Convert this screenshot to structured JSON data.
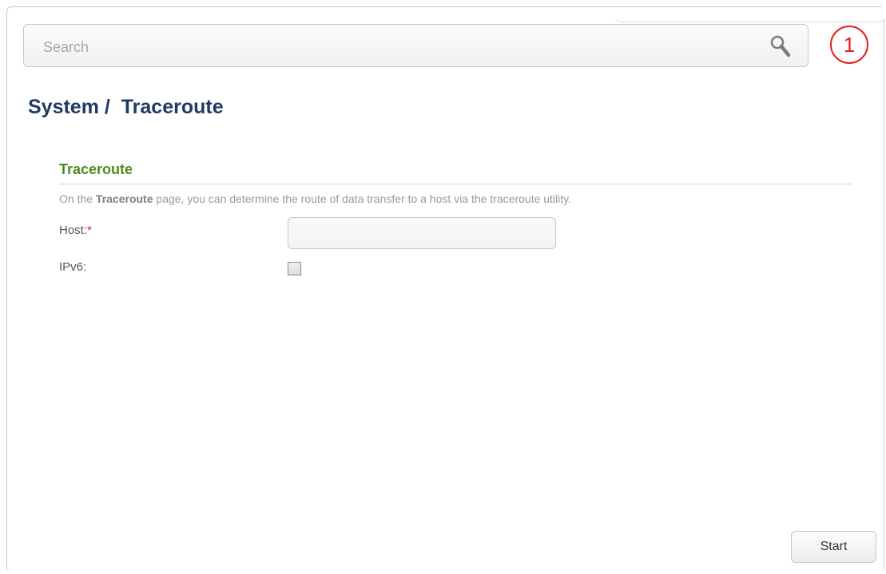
{
  "search": {
    "placeholder": "Search"
  },
  "callout": {
    "number": "1"
  },
  "breadcrumb": {
    "section": "System",
    "separator": "/",
    "page": "Traceroute"
  },
  "traceroute": {
    "title": "Traceroute",
    "description_prefix": "On the ",
    "description_bold": "Traceroute",
    "description_suffix": " page, you can determine the route of data transfer to a host via the traceroute utility.",
    "host_label": "Host:",
    "host_required_mark": "*",
    "host_value": "",
    "ipv6_label": "IPv6:",
    "ipv6_checked": false
  },
  "actions": {
    "start_label": "Start"
  },
  "colors": {
    "title": "#1f3b63",
    "section_title": "#4f8a1e",
    "callout": "#e02020"
  }
}
